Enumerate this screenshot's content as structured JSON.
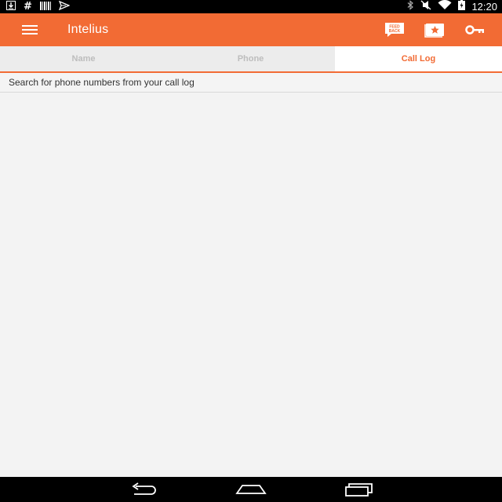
{
  "status_bar": {
    "left_icons": [
      "download-icon",
      "hash-icon",
      "barcode-icon",
      "send-icon"
    ],
    "hash_glyph": "#",
    "right_icons": [
      "bluetooth-icon",
      "mute-icon",
      "wifi-icon",
      "battery-icon"
    ],
    "time": "12:20"
  },
  "app_bar": {
    "title": "Intelius",
    "accent_color": "#f26b34",
    "actions": [
      "feedback-icon",
      "favorites-icon",
      "key-icon"
    ],
    "feedback_text_top": "FEED",
    "feedback_text_bottom": "BACK"
  },
  "tabs": [
    {
      "label": "Name",
      "active": false
    },
    {
      "label": "Phone",
      "active": false
    },
    {
      "label": "Call Log",
      "active": true
    }
  ],
  "search": {
    "placeholder": "Search for phone numbers from your call log"
  },
  "nav_bar": {
    "buttons": [
      "back-icon",
      "home-icon",
      "recents-icon"
    ]
  }
}
